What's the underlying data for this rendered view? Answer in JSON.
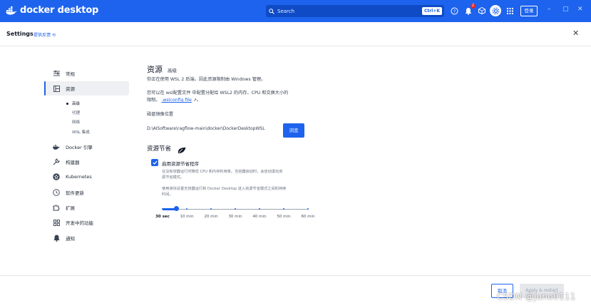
{
  "app": {
    "name": "docker desktop",
    "brand_color": "#1d63ed"
  },
  "topbar": {
    "search_label": "Search",
    "search_shortcut": "Ctrl+K",
    "notification_count": "2",
    "login_label": "登录",
    "icons": [
      "help-icon",
      "notification-icon",
      "extensions-icon",
      "settings-icon",
      "apps-grid-icon"
    ]
  },
  "header": {
    "title": "Settings",
    "feedback_link": "提供反馈"
  },
  "sidebar": {
    "items": [
      {
        "label": "常规",
        "icon": "sliders-icon"
      },
      {
        "label": "资源",
        "icon": "resources-icon"
      },
      {
        "label": "Docker 引擎",
        "icon": "docker-whale-icon"
      },
      {
        "label": "构建器",
        "icon": "wrench-icon"
      },
      {
        "label": "Kubernetes",
        "icon": "kubernetes-icon"
      },
      {
        "label": "软件更新",
        "icon": "clock-icon"
      },
      {
        "label": "扩展",
        "icon": "puzzle-icon"
      },
      {
        "label": "开发中的功能",
        "icon": "grid-icon"
      },
      {
        "label": "通知",
        "icon": "bell-icon"
      }
    ],
    "sub_items": [
      "高级",
      "代理",
      "网络",
      "WSL 集成"
    ]
  },
  "content": {
    "title": "资源",
    "tab": "高级",
    "wsl_notice": "你正在使用 WSL 2 后端，因此资源限制由 Windows 管理。",
    "config_line1": "您可以在 wsl配置文件 中配置分配给 WSL2 的内存、CPU 和交换大小的",
    "config_line2_prefix": "限制。",
    "config_link": ".wslconfig file",
    "config_line2_suffix": "。",
    "disk_label": "磁盘镜像位置",
    "disk_path": "D:\\AISoftware\\ragflow-main\\docker\\DockerDesktopWSL",
    "browse_label": "浏览",
    "saver_title": "资源节省",
    "saver_checkbox_label": "启用资源节省程序",
    "saver_checked": true,
    "saver_help1a": "在没有容器运行时降低 CPU 和内存利用率。当容器启动时，会自动退出资",
    "saver_help1b": "源节省模式。",
    "saver_help2a": "使用滑块设置无容器运行和 Docker Desktop 进入资源节省模式之间的持续",
    "saver_help2b": "时间。",
    "slider": {
      "selected_index": 1,
      "marks": [
        "30 sec",
        "10 min",
        "20 min",
        "30 min",
        "40 min",
        "50 min",
        "60 min"
      ]
    }
  },
  "footer": {
    "cancel_label": "取消",
    "apply_label": "Apply & restart",
    "watermark": "CSDN @juno0111"
  }
}
